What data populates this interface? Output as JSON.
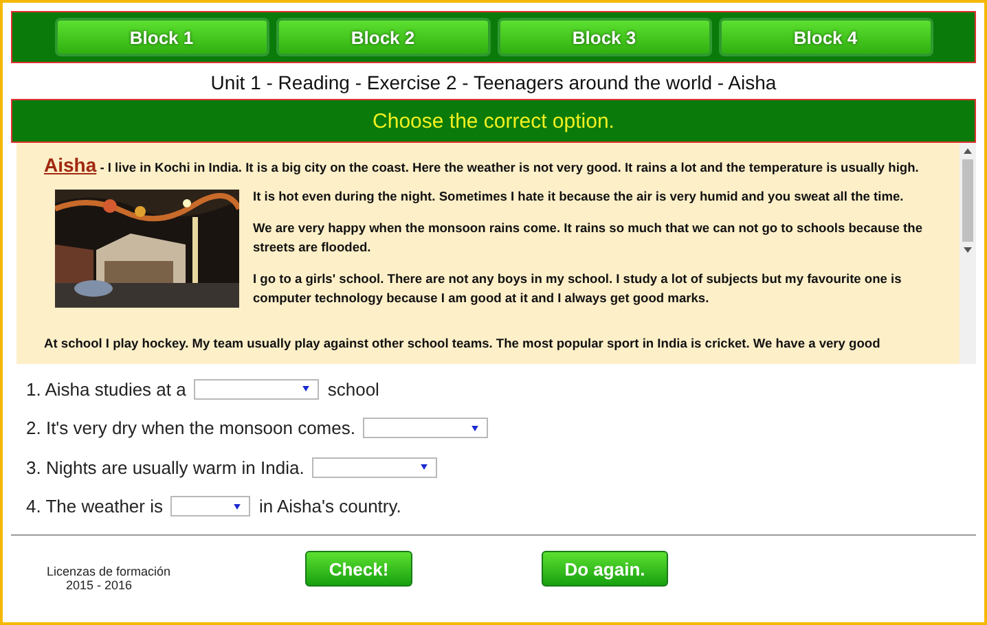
{
  "nav": [
    {
      "label": "Block 1"
    },
    {
      "label": "Block 2"
    },
    {
      "label": "Block 3"
    },
    {
      "label": "Block 4"
    }
  ],
  "title": "Unit 1 - Reading - Exercise 2 - Teenagers around the world - Aisha",
  "instruction": "Choose the correct option.",
  "reading": {
    "name": "Aisha",
    "intro": "- I live in Kochi in India. It is a big city on the coast. Here the weather is not very good. It rains a lot and the temperature is usually high.",
    "image": {
      "kind": "picture"
    },
    "paragraphs": [
      "It is hot even during the night. Sometimes I hate it because the air is very humid and you sweat all the time.",
      "We are very happy when the monsoon rains come. It rains so much that we can not go to schools because the streets are flooded.",
      "I go to a girls' school. There are not any boys in my school.  I study a lot of subjects but my favourite one  is computer technology because I am good at it and I always get good marks."
    ],
    "after": "At school I play hockey. My team usually play against other school teams. The most popular sport in India is cricket. We have a very good"
  },
  "questions": [
    {
      "before": "1. Aisha studies at a",
      "after": "school"
    },
    {
      "before": "2. It's very dry when the monsoon comes."
    },
    {
      "before": "3. Nights are usually warm in India."
    },
    {
      "before": "4. The weather is",
      "after": "in Aisha's country."
    }
  ],
  "footer": {
    "credit": [
      "Licenzas de formación",
      "2015 - 2016"
    ],
    "buttons": [
      {
        "label": "Check!"
      },
      {
        "label": "Do again."
      }
    ]
  }
}
